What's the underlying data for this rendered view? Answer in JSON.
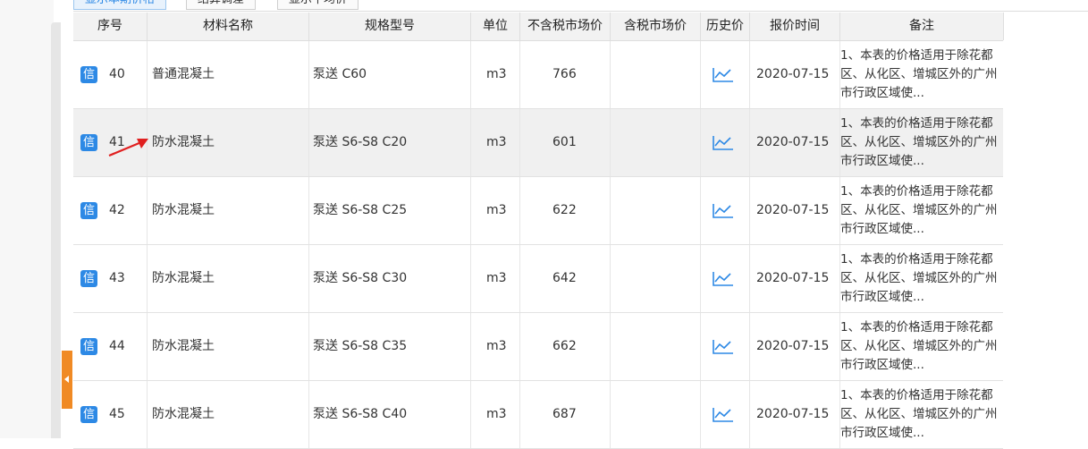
{
  "tabs": [
    {
      "label": "显示本期价格",
      "active": true
    },
    {
      "label": "结算调差",
      "active": false
    },
    {
      "label": "显示平均价",
      "active": false
    }
  ],
  "columns": [
    "序号",
    "材料名称",
    "规格型号",
    "单位",
    "不含税市场价",
    "含税市场价",
    "历史价",
    "报价时间",
    "备注"
  ],
  "badge_label": "信",
  "rows": [
    {
      "no": "40",
      "name": "普通混凝土",
      "spec": "泵送 C60",
      "unit": "m3",
      "price_ex": "766",
      "price_in": "",
      "date": "2020-07-15",
      "note": "1、本表的价格适用于除花都区、从化区、增城区外的广州市行政区域使..."
    },
    {
      "no": "41",
      "name": "防水混凝土",
      "spec": "泵送 S6-S8 C20",
      "unit": "m3",
      "price_ex": "601",
      "price_in": "",
      "date": "2020-07-15",
      "note": "1、本表的价格适用于除花都区、从化区、增城区外的广州市行政区域使..."
    },
    {
      "no": "42",
      "name": "防水混凝土",
      "spec": "泵送 S6-S8 C25",
      "unit": "m3",
      "price_ex": "622",
      "price_in": "",
      "date": "2020-07-15",
      "note": "1、本表的价格适用于除花都区、从化区、增城区外的广州市行政区域使..."
    },
    {
      "no": "43",
      "name": "防水混凝土",
      "spec": "泵送 S6-S8 C30",
      "unit": "m3",
      "price_ex": "642",
      "price_in": "",
      "date": "2020-07-15",
      "note": "1、本表的价格适用于除花都区、从化区、增城区外的广州市行政区域使..."
    },
    {
      "no": "44",
      "name": "防水混凝土",
      "spec": "泵送 S6-S8 C35",
      "unit": "m3",
      "price_ex": "662",
      "price_in": "",
      "date": "2020-07-15",
      "note": "1、本表的价格适用于除花都区、从化区、增城区外的广州市行政区域使..."
    },
    {
      "no": "45",
      "name": "防水混凝土",
      "spec": "泵送 S6-S8 C40",
      "unit": "m3",
      "price_ex": "687",
      "price_in": "",
      "date": "2020-07-15",
      "note": "1、本表的价格适用于除花都区、从化区、增城区外的广州市行政区域使..."
    }
  ],
  "selected_row": "41",
  "icons": {
    "history": "line-chart-icon",
    "collapse": "chevron-left-icon"
  },
  "colors": {
    "accent": "#2d89e5",
    "collapse_tab": "#f08a24",
    "annotation": "#e02020"
  }
}
